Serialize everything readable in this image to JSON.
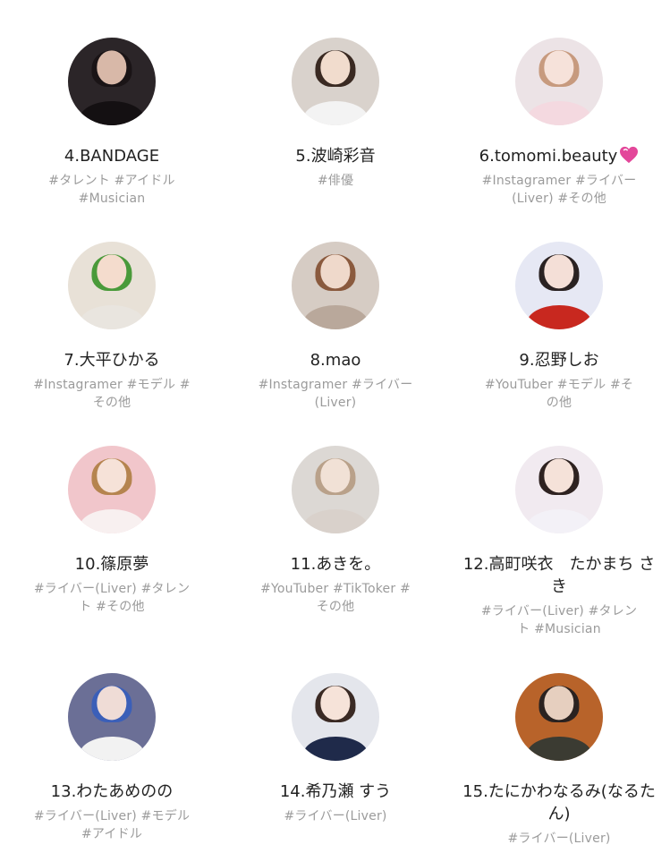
{
  "profiles": [
    {
      "name": "4.BANDAGE",
      "tags": "#タレント #アイドル #Musician",
      "colors": {
        "bg": "#2b2528",
        "hair": "#1a1416",
        "skin": "#d8b8a8",
        "body": "#141012"
      }
    },
    {
      "name": "5.波崎彩音",
      "tags": "#俳優",
      "colors": {
        "bg": "#d9d2cc",
        "hair": "#3a2a22",
        "skin": "#f1dccd",
        "body": "#f3f3f3"
      }
    },
    {
      "name": "6.tomomi.beauty",
      "tags": "#Instagramer #ライバー (Liver) #その他",
      "heart": true,
      "colors": {
        "bg": "#ece3e6",
        "hair": "#c79a7e",
        "skin": "#f6e2da",
        "body": "#f4d9e0"
      }
    },
    {
      "name": "7.大平ひかる",
      "tags": "#Instagramer #モデル #その他",
      "colors": {
        "bg": "#e8e1d7",
        "hair": "#4a9a3a",
        "skin": "#f4dccd",
        "body": "#e9e5df"
      }
    },
    {
      "name": "8.mao",
      "tags": "#Instagramer #ライバー (Liver)",
      "colors": {
        "bg": "#d6ccc4",
        "hair": "#8a5a3e",
        "skin": "#efd9cb",
        "body": "#b9a89b"
      }
    },
    {
      "name": "9.忍野しお",
      "tags": "#YouTuber #モデル #その他",
      "colors": {
        "bg": "#e6e8f4",
        "hair": "#2a2222",
        "skin": "#f4dfd7",
        "body": "#c8281f"
      }
    },
    {
      "name": "10.篠原夢",
      "tags": "#ライバー(Liver) #タレント #その他",
      "colors": {
        "bg": "#f1c6cb",
        "hair": "#b5844f",
        "skin": "#f6e2d8",
        "body": "#f8f0f0"
      }
    },
    {
      "name": "11.あきを。",
      "tags": "#YouTuber #TikToker #その他",
      "colors": {
        "bg": "#dcd8d4",
        "hair": "#b9a18a",
        "skin": "#f1e1d6",
        "body": "#d9d1cb"
      }
    },
    {
      "name": "12.高町咲衣　たかまち さき",
      "tags": "#ライバー(Liver) #タレント #Musician",
      "colors": {
        "bg": "#f1eaf0",
        "hair": "#2e2220",
        "skin": "#f5e2d9",
        "body": "#f3f1f7"
      }
    },
    {
      "name": "13.わたあめのの",
      "tags": "#ライバー(Liver) #モデル #アイドル",
      "colors": {
        "bg": "#6b6f96",
        "hair": "#3b5fb8",
        "skin": "#efdcd6",
        "body": "#f2f2f2"
      }
    },
    {
      "name": "14.希乃瀬 すう",
      "tags": "#ライバー(Liver)",
      "colors": {
        "bg": "#e4e6ec",
        "hair": "#3a2a24",
        "skin": "#f6e3d9",
        "body": "#1f2a4a"
      }
    },
    {
      "name": "15.たにかわなるみ(なるたん)",
      "tags": "#ライバー(Liver)",
      "colors": {
        "bg": "#b8632a",
        "hair": "#2a2220",
        "skin": "#e6cfbf",
        "body": "#3b3b32"
      }
    }
  ],
  "heart_color": "#e3479a"
}
